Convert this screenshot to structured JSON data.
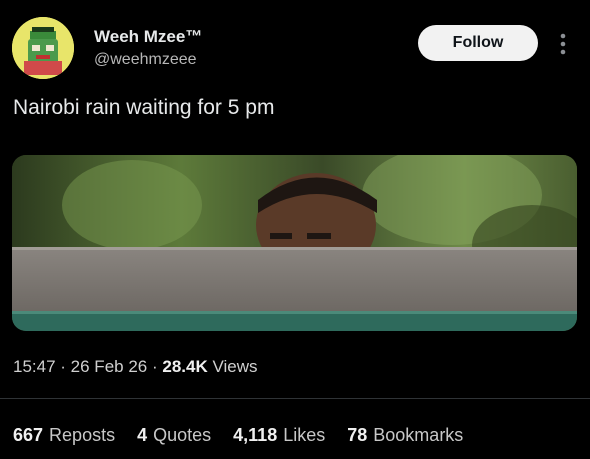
{
  "author": {
    "name": "Weeh Mzee™",
    "handle": "@weehmzeee",
    "avatar_icon": "profile-avatar"
  },
  "follow_label": "Follow",
  "more_icon": "more-vertical-icon",
  "tweet": {
    "text": "Nairobi rain waiting for 5 pm"
  },
  "meta": {
    "time": "15:47",
    "date": "26 Feb 26",
    "views_count": "28.4K",
    "views_label": "Views"
  },
  "stats": {
    "reposts_count": "667",
    "reposts_label": "Reposts",
    "quotes_count": "4",
    "quotes_label": "Quotes",
    "likes_count": "4,118",
    "likes_label": "Likes",
    "bookmarks_count": "78",
    "bookmarks_label": "Bookmarks"
  },
  "colors": {
    "background": "#000000",
    "follow_bg": "#f2f2f2",
    "text": "#e7e9ea",
    "muted": "#b7b7b7"
  }
}
